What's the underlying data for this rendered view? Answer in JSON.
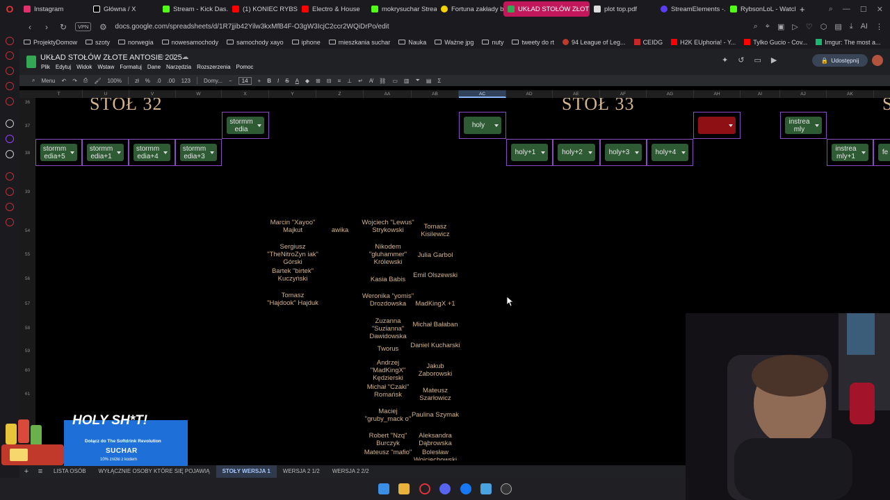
{
  "browser": {
    "tabs": [
      {
        "label": "Instagram",
        "color": "#e1306c"
      },
      {
        "label": "Główna / X",
        "color": "#ffffff"
      },
      {
        "label": "Stream - Kick Das...",
        "color": "#53fc18"
      },
      {
        "label": "(1) KONIEC RYBSO...",
        "color": "#ff0000"
      },
      {
        "label": "Electro & House",
        "color": "#ff0000"
      },
      {
        "label": "mokrysuchar Strea...",
        "color": "#53fc18"
      },
      {
        "label": "Fortuna zakłady bu...",
        "color": "#f5d300"
      },
      {
        "label": "UKŁAD STOŁÓW ZŁOTE A...",
        "color": "#34a853",
        "active": true
      },
      {
        "label": "plot top.pdf",
        "color": "#dddddd"
      },
      {
        "label": "StreamElements -...",
        "color": "#5b3cf5"
      },
      {
        "label": "RybsonLoL - Watch...",
        "color": "#53fc18"
      }
    ],
    "url": "docs.google.com/spreadsheets/d/1R7jjib42Yilw3kxMfB4F-O3gW3IcjC2ccr2WQiDrPo/edit",
    "vpn_label": "VPN",
    "bookmarks": [
      {
        "label": "ProjektyDomow"
      },
      {
        "label": "szoty"
      },
      {
        "label": "norwegia"
      },
      {
        "label": "nowesamochody"
      },
      {
        "label": "samochody xayo"
      },
      {
        "label": "iphone"
      },
      {
        "label": "mieszkania suchar"
      },
      {
        "label": "Nauka"
      },
      {
        "label": "Ważne jpg"
      },
      {
        "label": "nuty"
      },
      {
        "label": "tweety do rt"
      },
      {
        "label": "94 League of Leg..."
      },
      {
        "label": "CEIDG"
      },
      {
        "label": "H2K EUphoria! - Y..."
      },
      {
        "label": "Tylko Gucio - Cov..."
      },
      {
        "label": "Imgur: The most a..."
      }
    ]
  },
  "sheets": {
    "title": "UKŁAD STOŁÓW ZŁOTE ANTOSIE 2025",
    "menus": [
      "Plik",
      "Edytuj",
      "Widok",
      "Wstaw",
      "Formatuj",
      "Dane",
      "Narzędzia",
      "Rozszerzenia",
      "Pomoc"
    ],
    "share_label": "Udostępnij",
    "toolbar": {
      "menu_label": "Menu",
      "zoom": "100%",
      "format_pct": "%",
      "format_dec1": ".0",
      "format_dec2": ".00",
      "format_123": "123",
      "font": "Domy...",
      "font_size": "14"
    },
    "columns": [
      "T",
      "U",
      "V",
      "W",
      "X",
      "Y",
      "Z",
      "AA",
      "AB",
      "AC",
      "AD",
      "AE",
      "AF",
      "AG",
      "AH",
      "AI",
      "AJ",
      "AK"
    ],
    "selected_column": "AC",
    "rows": [
      "36",
      "37",
      "38",
      "39",
      "54",
      "55",
      "56",
      "57",
      "58",
      "59",
      "60",
      "61"
    ],
    "tables": [
      {
        "title": "STÓŁ 32"
      },
      {
        "title": "STÓŁ 33"
      },
      {
        "title": "S"
      }
    ],
    "seats": {
      "stormm_edia": "stormm edia",
      "stormm_edia_5": "stormm edia+5",
      "stormm_edia_1": "stormm edia+1",
      "stormm_edia_4": "stormm edia+4",
      "stormm_edia_3": "stormm edia+3",
      "holy": "holy",
      "holy_1": "holy+1",
      "holy_2": "holy+2",
      "holy_3": "holy+3",
      "holy_4": "holy+4",
      "instrea_mly": "instrea mly",
      "instrea_mly_1": "instrea mly+1",
      "fe": "fe"
    },
    "names_col_y": [
      "Marcin \"Xayoo\" Majkut",
      "Sergiusz \"TheNitroZyn iak\" Górski",
      "Bartek \"birtek\" Kuczyński",
      "Tomasz \"Hajdook\" Hajduk"
    ],
    "names_col_z": [
      "awika"
    ],
    "names_col_aa": [
      "Wojciech \"Lewus\" Strykowski",
      "Nikodem \"gluhammer\" Królewski",
      "Kasia Babis",
      "Weronika \"yomis\" Drozdowska",
      "Zuzanna \"Suzianna\" Dawidowska",
      "Tworus",
      "Andrzej \"MadKingX\" Kędzierski",
      "Michał \"Czaki\" Romańsk",
      "Maciej \"gruby_mack o\"",
      "Robert \"Nzq\" Burczyk",
      "Mateusz \"mafio\""
    ],
    "names_col_ab": [
      "Tomasz Kisilewicz",
      "Julia Garbol",
      "Emil Olszewski",
      "MadKingX +1",
      "Michał Bałaban",
      "Daniel Kucharski",
      "Jakub Zaborowski",
      "Mateusz Szarłowicz",
      "Paulina Szymak",
      "Aleksandra Dąbrowska",
      "Bolesław Wojciechowski"
    ],
    "sheet_tabs": [
      "LISTA OSÓB",
      "WYŁĄCZNIE OSOBY KTÓRE SIĘ POJAWIĄ",
      "STOŁY WERSJA 1",
      "WERSJA 2 1/2",
      "WERSJA 2 2/2"
    ],
    "active_sheet": "STOŁY WERSJA 1"
  },
  "overlay_ad": {
    "title": "HOLY SH*T!",
    "line1": "Dołącz do The Softdrink Revolution",
    "brand": "SUCHAR",
    "line2": "10% zniżki z kodem"
  },
  "colors": {
    "accent_tab": "#c2185b",
    "seat_green": "#2e5a34",
    "seat_border": "#8a4dbf",
    "name_gold": "#d4b48a",
    "ad_blue": "#1e6fd8"
  }
}
